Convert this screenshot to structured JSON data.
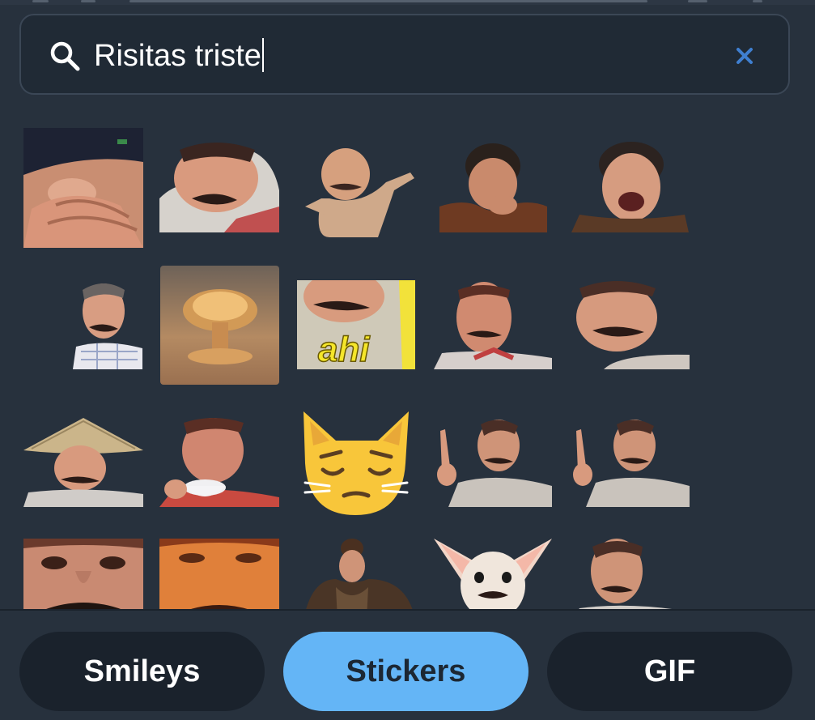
{
  "search": {
    "value": "Risitas triste"
  },
  "tabs": [
    {
      "label": "Smileys",
      "active": false
    },
    {
      "label": "Stickers",
      "active": true
    },
    {
      "label": "GIF",
      "active": false
    }
  ],
  "icons": {
    "search": "search-icon",
    "clear": "close-icon"
  },
  "colors": {
    "background": "#27313d",
    "search_background": "#202a35",
    "clear_icon": "#3f7fd0",
    "active_tab": "#64b5f6",
    "inactive_tab": "#1a222c"
  },
  "stickers": [
    {
      "name": "risitas-beanie-hands-face-sticker"
    },
    {
      "name": "risitas-laughing-sticker"
    },
    {
      "name": "risitas-dancing-sticker"
    },
    {
      "name": "man-laughing-hand-on-face-sticker"
    },
    {
      "name": "man-laughing-eyes-closed-sticker"
    },
    {
      "name": "risitas-small-smile-sticker"
    },
    {
      "name": "nuclear-explosion-sticker"
    },
    {
      "name": "risitas-ahi-sticker",
      "caption": "ahi"
    },
    {
      "name": "risitas-surprised-sticker"
    },
    {
      "name": "risitas-grin-sticker"
    },
    {
      "name": "risitas-straw-hat-sticker"
    },
    {
      "name": "risitas-teacup-sticker"
    },
    {
      "name": "pensive-cat-sticker"
    },
    {
      "name": "risitas-pointing-up-sticker"
    },
    {
      "name": "risitas-pointing-up-sticker-2"
    },
    {
      "name": "risitas-eyes-closeup-sticker"
    },
    {
      "name": "risitas-orange-closeup-sticker"
    },
    {
      "name": "risitas-fur-coat-sticker"
    },
    {
      "name": "chihuahua-moustache-sticker"
    },
    {
      "name": "risitas-leaning-sticker"
    }
  ]
}
